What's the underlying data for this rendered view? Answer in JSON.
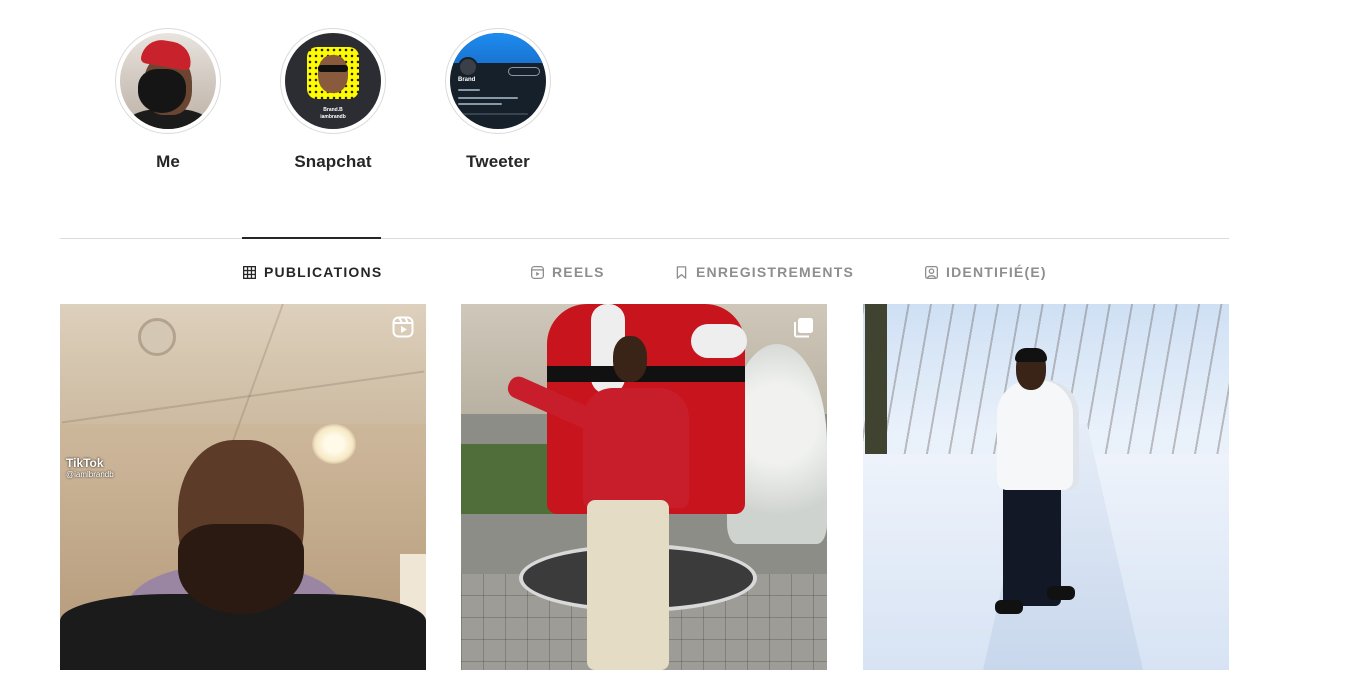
{
  "highlights": [
    {
      "label": "Me"
    },
    {
      "label": "Snapchat",
      "caption_line1": "Brand.B",
      "caption_line2": "iambrandb"
    },
    {
      "label": "Tweeter",
      "profile_name": "Brand"
    }
  ],
  "tabs": [
    {
      "label": "PUBLICATIONS",
      "icon": "grid-icon",
      "active": true
    },
    {
      "label": "REELS",
      "icon": "reels-icon",
      "active": false
    },
    {
      "label": "ENREGISTREMENTS",
      "icon": "bookmark-icon",
      "active": false
    },
    {
      "label": "IDENTIFIÉ(E)",
      "icon": "tagged-person-icon",
      "active": false
    }
  ],
  "posts": [
    {
      "badge_icon": "reel-icon",
      "overlay_brand": "TikTok",
      "overlay_handle": "@iamlbrandb"
    },
    {
      "badge_icon": "carousel-icon"
    },
    {
      "badge_icon": null
    }
  ],
  "colors": {
    "text_primary": "#262626",
    "text_secondary": "#8e8e8e",
    "divider": "#dbdbdb"
  }
}
